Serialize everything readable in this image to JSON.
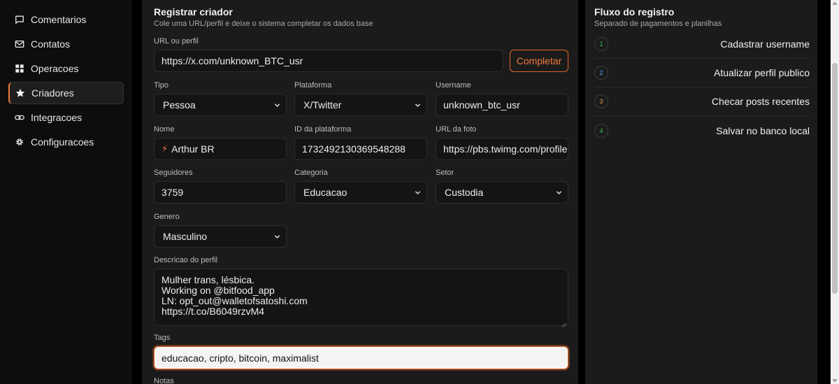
{
  "sidebar": {
    "items": [
      {
        "label": "Comentarios",
        "icon": "message-square-icon"
      },
      {
        "label": "Contatos",
        "icon": "mail-icon"
      },
      {
        "label": "Operacoes",
        "icon": "grid-icon"
      },
      {
        "label": "Criadores",
        "icon": "star-icon"
      },
      {
        "label": "Integracoes",
        "icon": "link-icon"
      },
      {
        "label": "Configuracoes",
        "icon": "gear-icon"
      }
    ],
    "active_index": 3
  },
  "form": {
    "title": "Registrar criador",
    "subtitle": "Cole uma URL/perfil e deixe o sistema completar os dados base",
    "url_label": "URL ou perfil",
    "url_value": "https://x.com/unknown_BTC_usr",
    "complete_button": "Completar",
    "tipo_label": "Tipo",
    "tipo_value": "Pessoa",
    "plataforma_label": "Plataforma",
    "plataforma_value": "X/Twitter",
    "username_label": "Username",
    "username_value": "unknown_btc_usr",
    "nome_label": "Nome",
    "nome_value": "Arthur BR",
    "id_label": "ID da plataforma",
    "id_value": "1732492130369548288",
    "foto_label": "URL da foto",
    "foto_value": "https://pbs.twimg.com/profile",
    "seguidores_label": "Seguidores",
    "seguidores_value": "3759",
    "categoria_label": "Categoria",
    "categoria_value": "Educacao",
    "setor_label": "Setor",
    "setor_value": "Custodia",
    "genero_label": "Genero",
    "genero_value": "Masculino",
    "descricao_label": "Descricao do perfil",
    "descricao_lines": [
      "Mulher trans, lésbica.",
      "Working on @bitfood_app",
      "LN: opt_out@walletofsatoshi.com",
      "https://t.co/B6049rzvM4"
    ],
    "tags_label": "Tags",
    "tags_value": "educacao, cripto, bitcoin, maximalist",
    "notas_label": "Notas"
  },
  "flow": {
    "title": "Fluxo do registro",
    "subtitle": "Separado de pagamentos e planilhas",
    "steps": [
      {
        "number": "1",
        "label": "Cadastrar username",
        "color": "#3fb950"
      },
      {
        "number": "2",
        "label": "Atualizar perfil publico",
        "color": "#58a6ff"
      },
      {
        "number": "3",
        "label": "Checar posts recentes",
        "color": "#e3a040"
      },
      {
        "number": "4",
        "label": "Salvar no banco local",
        "color": "#3fb950"
      }
    ]
  },
  "colors": {
    "accent": "#f07a3c",
    "panel": "#1b1b1b",
    "background": "#000000"
  }
}
